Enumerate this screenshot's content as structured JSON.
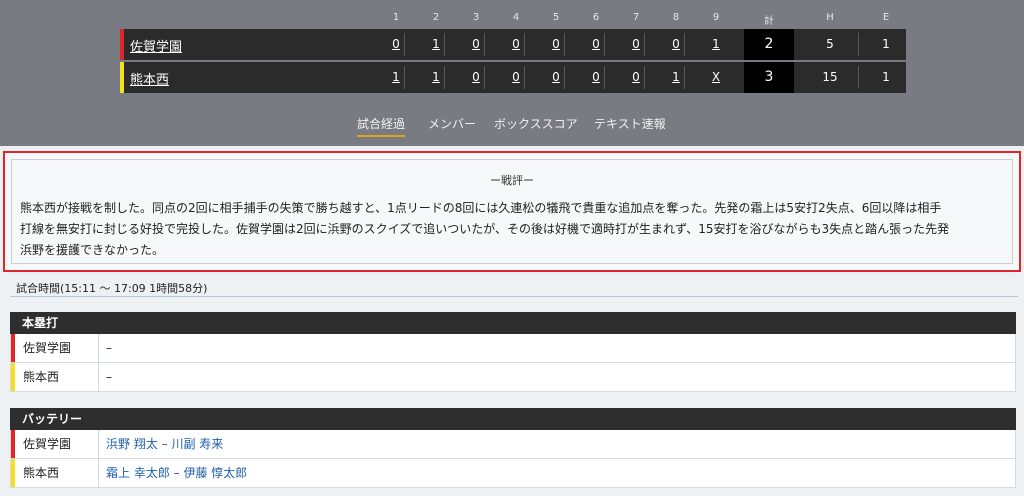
{
  "scoreboard": {
    "headers": [
      "1",
      "2",
      "3",
      "4",
      "5",
      "6",
      "7",
      "8",
      "9",
      "計",
      "H",
      "E"
    ],
    "teams": [
      {
        "name": "佐賀学園",
        "color": "#e0262b",
        "innings": [
          "0",
          "1",
          "0",
          "0",
          "0",
          "0",
          "0",
          "0",
          "1"
        ],
        "total": "2",
        "hits": "5",
        "errors": "1"
      },
      {
        "name": "熊本西",
        "color": "#f3e21b",
        "innings": [
          "1",
          "1",
          "0",
          "0",
          "0",
          "0",
          "0",
          "1",
          "X"
        ],
        "total": "3",
        "hits": "15",
        "errors": "1"
      }
    ]
  },
  "tabs": [
    "試合経過",
    "メンバー",
    "ボックススコア",
    "テキスト速報"
  ],
  "summary": {
    "title": "ー戦評ー",
    "lines": [
      "熊本西が接戦を制した。同点の2回に相手捕手の失策で勝ち越すと、1点リードの8回には久連松の犠飛で貴重な追加点を奪った。先発の霜上は5安打2失点、6回以降は相手",
      "打線を無安打に封じる好投で完投した。佐賀学園は2回に浜野のスクイズで追いついたが、その後は好機で適時打が生まれず、15安打を浴びながらも3失点と踏ん張った先発",
      "浜野を援護できなかった。"
    ]
  },
  "game_time": "試合時間(15:11 〜 17:09 1時間58分)",
  "homerun": {
    "title": "本塁打",
    "rows": [
      {
        "team": "佐賀学園",
        "value": "–"
      },
      {
        "team": "熊本西",
        "value": "–"
      }
    ]
  },
  "battery": {
    "title": "バッテリー",
    "rows": [
      {
        "team": "佐賀学園",
        "value": "浜野 翔太 – 川副 寿来"
      },
      {
        "team": "熊本西",
        "value": "霜上 幸太郎 – 伊藤 惇太郎"
      }
    ]
  }
}
